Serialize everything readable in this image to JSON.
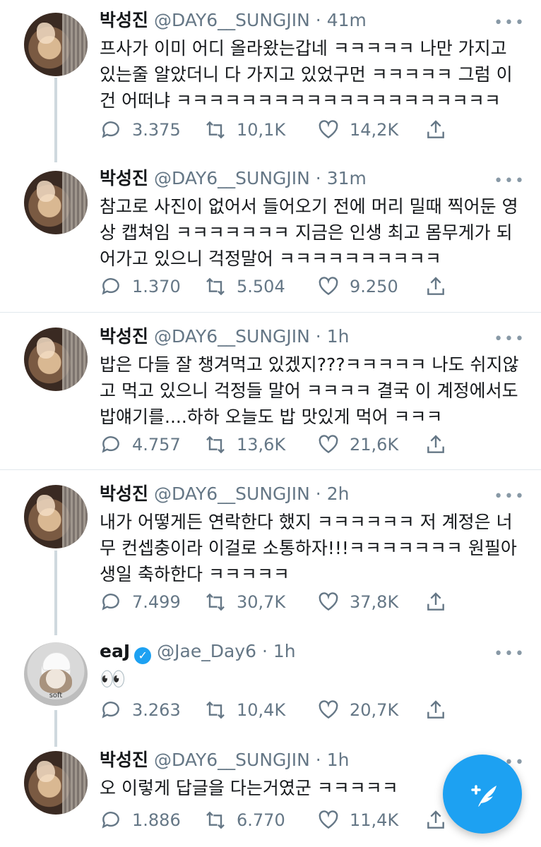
{
  "tweets": [
    {
      "name": "박성진",
      "handle": "@DAY6__SUNGJIN",
      "time": "41m",
      "text": "프사가 이미 어디 올라왔는갑네 ㅋㅋㅋㅋㅋ 나만 가지고 있는줄 알았더니 다 가지고 있었구먼 ㅋㅋㅋㅋㅋ 그럼 이건 어떠냐 ㅋㅋㅋㅋㅋㅋㅋㅋㅋㅋㅋㅋㅋㅋㅋㅋㅋㅋㅋㅋ",
      "replies": "3.375",
      "retweets": "10,1K",
      "likes": "14,2K"
    },
    {
      "name": "박성진",
      "handle": "@DAY6__SUNGJIN",
      "time": "31m",
      "text": "참고로 사진이 없어서 들어오기 전에 머리 밀때 찍어둔 영상 캡쳐임 ㅋㅋㅋㅋㅋㅋㅋ 지금은 인생 최고 몸무게가 되어가고 있으니 걱정말어 ㅋㅋㅋㅋㅋㅋㅋㅋㅋㅋ",
      "replies": "1.370",
      "retweets": "5.504",
      "likes": "9.250"
    },
    {
      "name": "박성진",
      "handle": "@DAY6__SUNGJIN",
      "time": "1h",
      "text": "밥은 다들 잘 챙겨먹고 있겠지???ㅋㅋㅋㅋㅋ 나도 쉬지않고 먹고 있으니 걱정들 말어 ㅋㅋㅋㅋ 결국 이 계정에서도 밥얘기를....하하 오늘도 밥 맛있게 먹어 ㅋㅋㅋ",
      "replies": "4.757",
      "retweets": "13,6K",
      "likes": "21,6K"
    },
    {
      "name": "박성진",
      "handle": "@DAY6__SUNGJIN",
      "time": "2h",
      "text": "내가 어떻게든 연락한다 했지 ㅋㅋㅋㅋㅋㅋ 저 계정은 너무 컨셉충이라 이걸로 소통하자!!!ㅋㅋㅋㅋㅋㅋㅋ 원필아 생일 축하한다 ㅋㅋㅋㅋㅋ",
      "replies": "7.499",
      "retweets": "30,7K",
      "likes": "37,8K"
    },
    {
      "name": "eaJ",
      "handle": "@Jae_Day6",
      "time": "1h",
      "text": "👀",
      "avatar_caption": "soft",
      "replies": "3.263",
      "retweets": "10,4K",
      "likes": "20,7K"
    },
    {
      "name": "박성진",
      "handle": "@DAY6__SUNGJIN",
      "time": "1h",
      "text": "오 이렇게 답글을 다는거였군 ㅋㅋㅋㅋㅋ",
      "replies": "1.886",
      "retweets": "6.770",
      "likes": "11,4K"
    }
  ],
  "icons": {
    "more": "more-icon",
    "reply": "reply-icon",
    "retweet": "retweet-icon",
    "like": "like-icon",
    "share": "share-icon",
    "verified": "verified-badge-icon",
    "compose": "compose-tweet-icon"
  },
  "colors": {
    "accent": "#1da1f2",
    "secondary_text": "#657786",
    "divider": "#e1e8ed",
    "thread_line": "#cfd9de"
  }
}
